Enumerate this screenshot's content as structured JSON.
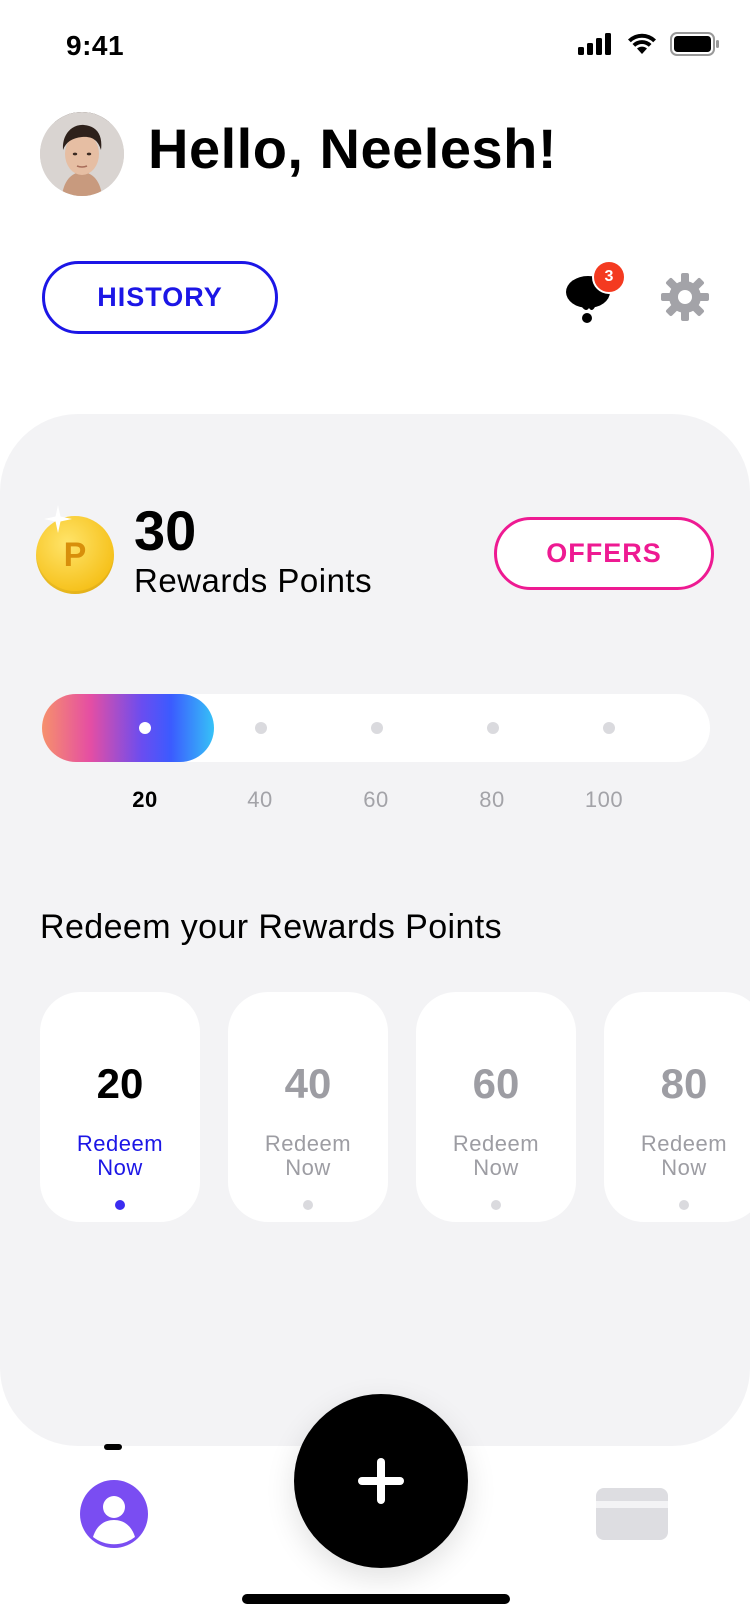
{
  "status_bar": {
    "time": "9:41"
  },
  "header": {
    "greeting": "Hello, Neelesh!",
    "history_label": "HISTORY",
    "notification_count": "3"
  },
  "rewards": {
    "points": "30",
    "points_label": "Rewards Points",
    "offers_label": "OFFERS",
    "progress": {
      "current": 20,
      "max": 100,
      "fill_fraction": 0.2
    },
    "ticks": [
      "20",
      "40",
      "60",
      "80",
      "100"
    ]
  },
  "redeem": {
    "title": "Redeem your Rewards Points",
    "items": [
      {
        "amount": "20",
        "label_line1": "Redeem",
        "label_line2": "Now"
      },
      {
        "amount": "40",
        "label_line1": "Redeem",
        "label_line2": "Now"
      },
      {
        "amount": "60",
        "label_line1": "Redeem",
        "label_line2": "Now"
      },
      {
        "amount": "80",
        "label_line1": "Redeem",
        "label_line2": "Now"
      }
    ]
  },
  "colors": {
    "history_accent": "#1c16e6",
    "offers_accent": "#ee1a92",
    "badge": "#f43a20",
    "coin": "#f6c21d",
    "profile_tab": "#7a4df2"
  },
  "icons": [
    "signal-icon",
    "wifi-icon",
    "battery-icon",
    "chat-icon",
    "gear-icon",
    "coin-icon",
    "sparkle-icon",
    "profile-icon",
    "plus-icon",
    "card-icon"
  ]
}
